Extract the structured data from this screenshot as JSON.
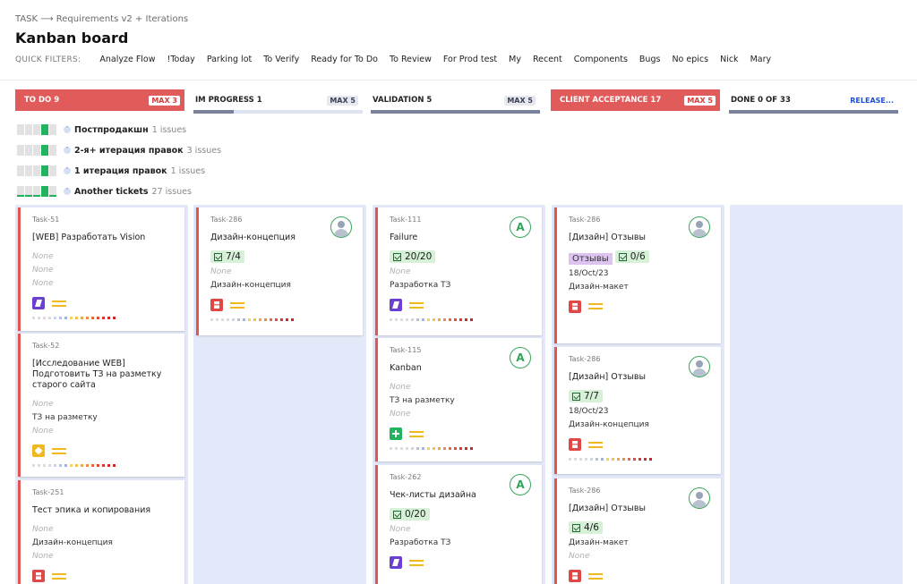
{
  "breadcrumb": "TASK ⟶ Requirements v2 + Iterations",
  "title": "Kanban board",
  "quick_filters": {
    "label": "QUICK FILTERS:",
    "items": [
      "Analyze Flow",
      "!Today",
      "Parking lot",
      "To Verify",
      "Ready for To Do",
      "To Review",
      "For Prod test",
      "My",
      "Recent",
      "Components",
      "Bugs",
      "No epics",
      "Nick",
      "Mary"
    ]
  },
  "columns": [
    {
      "name": "TO DO 9",
      "max": "MAX 3",
      "over_limit": true
    },
    {
      "name": "IM PROGRESS 1",
      "max": "MAX 5",
      "over_limit": false,
      "progress": 0.24
    },
    {
      "name": "VALIDATION 5",
      "max": "MAX 5",
      "over_limit": false,
      "progress": 1.0
    },
    {
      "name": "CLIENT ACCEPTANCE 17",
      "max": "MAX 5",
      "over_limit": true
    },
    {
      "name": "DONE 0 OF 33",
      "action": "RELEASE...",
      "progress": 1.0
    }
  ],
  "swimlanes": [
    {
      "name": "Постпродакшн",
      "count": "1 issues",
      "toggle": "˅"
    },
    {
      "name": "2-я+ итерация правок",
      "count": "3 issues",
      "toggle": "˅"
    },
    {
      "name": "1 итерация правок",
      "count": "1 issues",
      "toggle": "˅"
    },
    {
      "name": "Another tickets",
      "count": "27 issues",
      "toggle": "˄"
    }
  ],
  "none_label": "None",
  "cards": {
    "c1": {
      "key": "Task-51",
      "summary": "[WEB] Разработать Vision"
    },
    "c2": {
      "key": "Task-52",
      "summary": "[Исследование WEB] Подготовить ТЗ на разметку старого сайта",
      "field": "ТЗ на разметку"
    },
    "c3": {
      "key": "Task-251",
      "summary": "Тест эпика и копирования",
      "field": "Дизайн-концепция"
    },
    "c4": {
      "key": "Task-286",
      "summary": "Дизайн-концепция",
      "checklist": "7/4",
      "field": "Дизайн-концепция"
    },
    "c5": {
      "key": "Task-111",
      "summary": "Failure",
      "checklist": "20/20",
      "field": "Разработка ТЗ",
      "avatar": "A"
    },
    "c6": {
      "key": "Task-115",
      "summary": "Kanban",
      "field": "ТЗ на разметку",
      "avatar": "A"
    },
    "c7": {
      "key": "Task-262",
      "summary": "Чек-листы дизайна",
      "checklist": "0/20",
      "field": "Разработка ТЗ",
      "avatar": "A"
    },
    "c8": {
      "key": "Task-286",
      "summary": "[Дизайн] Отзывы",
      "tag": "Отзывы",
      "checklist": "0/6",
      "date": "18/Oct/23",
      "field": "Дизайн-макет"
    },
    "c9": {
      "key": "Task-286",
      "summary": "[Дизайн] Отзывы",
      "checklist": "7/7",
      "date": "18/Oct/23",
      "field": "Дизайн-концепция"
    },
    "c10": {
      "key": "Task-286",
      "summary": "[Дизайн] Отзывы",
      "checklist": "4/6",
      "field": "Дизайн-макет"
    }
  },
  "colors": {
    "over_limit": "#e15b5b",
    "priority": "#f2b820",
    "column_bg": "#e3e9f8",
    "done_green": "#22b35e"
  }
}
